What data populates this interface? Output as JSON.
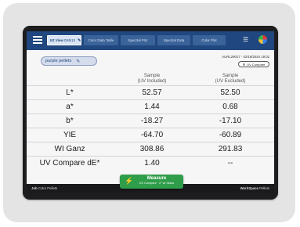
{
  "topbar": {
    "tabs": [
      {
        "label": "EZ View",
        "sub": "D65/10",
        "active": true
      },
      {
        "label": "Color Data Table",
        "active": false
      },
      {
        "label": "Spectral Plot",
        "active": false
      },
      {
        "label": "Spectral Data",
        "active": false
      },
      {
        "label": "Color Plot",
        "active": false
      }
    ]
  },
  "sample": {
    "name": "purple pellets"
  },
  "info": {
    "device": "AURL29017",
    "datetime": "02/19/2024 19:02"
  },
  "uv_button": {
    "label": "UV Compare"
  },
  "columns": [
    {
      "line1": "Sample",
      "line2": "(UV Included)"
    },
    {
      "line1": "Sample",
      "line2": "(UV Excluded)"
    }
  ],
  "rows": [
    {
      "label": "L*",
      "uv_included": "52.57",
      "uv_excluded": "52.50"
    },
    {
      "label": "a*",
      "uv_included": "1.44",
      "uv_excluded": "0.68"
    },
    {
      "label": "b*",
      "uv_included": "-18.27",
      "uv_excluded": "-17.10"
    },
    {
      "label": "YIE",
      "uv_included": "-64.70",
      "uv_excluded": "-60.89"
    },
    {
      "label": "WI Ganz",
      "uv_included": "308.86",
      "uv_excluded": "291.83"
    },
    {
      "label": "UV Compare dE*",
      "uv_included": "1.40",
      "uv_excluded": "--"
    }
  ],
  "measure": {
    "title": "Measure",
    "subtitle": "UV Compare · 2\" w/ Glass"
  },
  "bottombar": {
    "job_label": "Job",
    "job_value": "Color Pellets",
    "ws_label": "WorkSpace",
    "ws_value": "Pellets"
  },
  "colors": {
    "accent": "#20477f",
    "measure": "#2f9e4a",
    "background": "#e4e4e4"
  }
}
